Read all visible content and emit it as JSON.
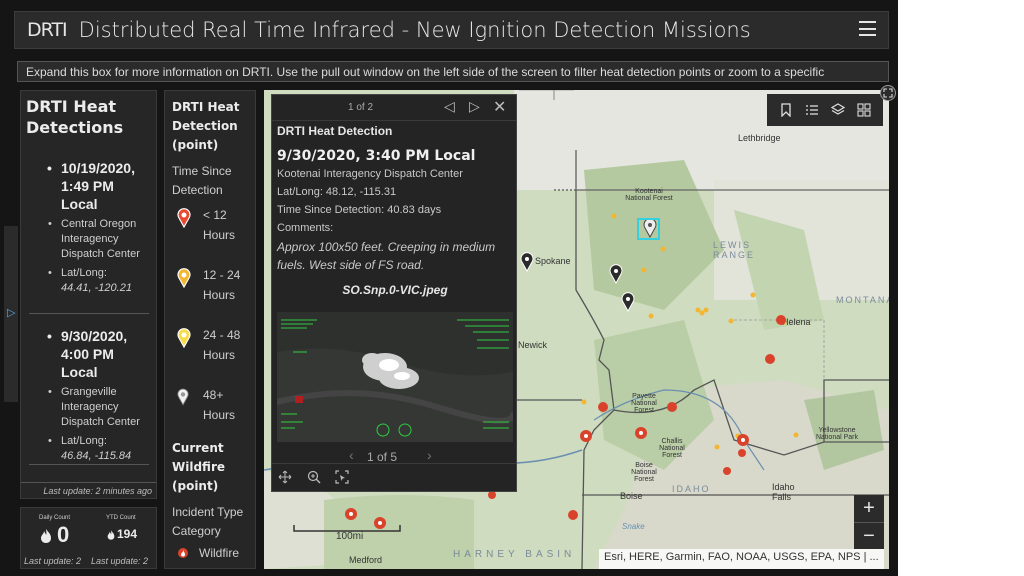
{
  "header": {
    "logo": "DRTI",
    "title": "Distributed Real Time Infrared - New Ignition Detection Missions",
    "menu_icon": "hamburger-menu-icon"
  },
  "info_bar": {
    "text": "Expand this box for more information on DRTI. Use the pull out window on the left side of the screen to filter heat detection points or zoom to a specific"
  },
  "detections": {
    "title": "DRTI Heat Detections",
    "items": [
      {
        "when": "10/19/2020, 1:49 PM Local",
        "center": "Central Oregon Interagency Dispatch Center",
        "latlong_label": "Lat/Long:",
        "latlong": "44.41, -120.21"
      },
      {
        "when": "9/30/2020, 4:00 PM Local",
        "center": "Grangeville Interagency Dispatch Center",
        "latlong_label": "Lat/Long:",
        "latlong": "46.84, -115.84"
      }
    ],
    "last_update": "Last update: 2 minutes ago"
  },
  "counts": {
    "daily_label": "Daily Count",
    "daily_value": "0",
    "ytd_label": "YTD Count",
    "ytd_value": "194",
    "last_update_left": "Last update: 2",
    "last_update_right": "Last update: 2"
  },
  "legend": {
    "section1_title": "DRTI Heat Detection (point)",
    "section1_sub": "Time Since Detection",
    "rows": [
      {
        "label": "< 12 Hours",
        "color": "#e8492f"
      },
      {
        "label": "12 - 24 Hours",
        "color": "#f2b632"
      },
      {
        "label": "24 - 48 Hours",
        "color": "#f6dc4a"
      },
      {
        "label": "48+ Hours",
        "color": "#f2f2f2"
      }
    ],
    "section2_title": "Current Wildfire (point)",
    "section2_sub": "Incident Type Category",
    "wildfire_label": "Wildfire"
  },
  "popup": {
    "pager": "1 of 2",
    "layer": "DRTI Heat Detection",
    "when": "9/30/2020, 3:40 PM Local",
    "center": "Kootenai Interagency Dispatch Center",
    "latlong": "Lat/Long: 48.12, -115.31",
    "time_since": "Time Since Detection: 40.83 days",
    "comments_label": "Comments:",
    "comments": "Approx 100x50 feet. Creeping in medium fuels. West side of FS road.",
    "image_name": "SO.Snp.0-VIC.jpeg",
    "media_pager": "1 of 5"
  },
  "map": {
    "cities": [
      {
        "name": "Lethbridge"
      },
      {
        "name": "Spokane"
      },
      {
        "name": "Helena"
      },
      {
        "name": "Boise"
      },
      {
        "name": "Idaho Falls"
      },
      {
        "name": "Medford"
      },
      {
        "name": "Kootenai National Forest"
      },
      {
        "name": "Payette National Forest"
      },
      {
        "name": "Challis National Forest"
      },
      {
        "name": "Boise National Forest"
      },
      {
        "name": "Yellowstone National Park"
      },
      {
        "name": "Newick"
      },
      {
        "name": "Snake"
      }
    ],
    "regions": [
      {
        "name": "LEWIS RANGE"
      },
      {
        "name": "MONTANA"
      },
      {
        "name": "IDAHO"
      },
      {
        "name": "HARNEY BASIN"
      }
    ],
    "scale_label": "100mi",
    "attribution": "Esri, HERE, Garmin, FAO, NOAA, USGS, EPA, NPS | ...",
    "zoom_in": "+",
    "zoom_out": "−"
  }
}
